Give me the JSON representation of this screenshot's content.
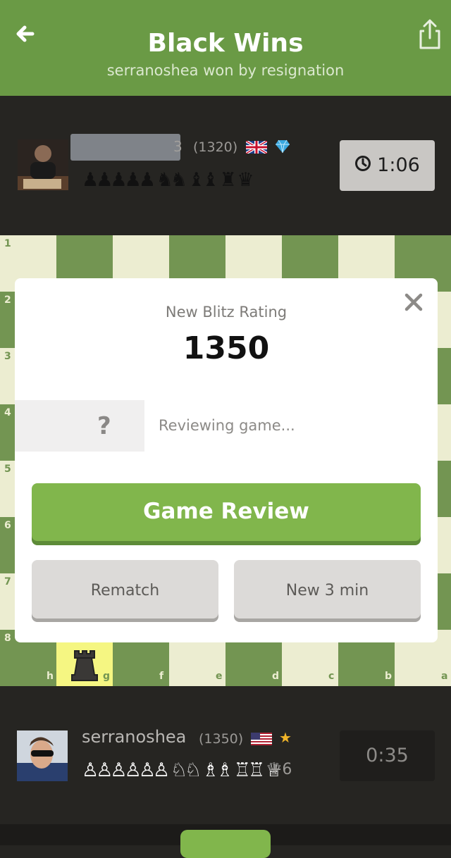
{
  "header": {
    "title": "Black Wins",
    "subtitle": "serranoshea won by resignation"
  },
  "opponent": {
    "name_visible_tail": "3",
    "rating": "(1320)",
    "flag": "uk-flag",
    "badge": "diamond-icon",
    "captured": "♟♟♟♟♟ ♞♞ ♝♝ ♜ ♛",
    "clock": "1:06"
  },
  "player": {
    "name": "serranoshea",
    "rating": "(1350)",
    "flag": "us-flag",
    "badge": "★",
    "captured": "♙♙♙♙♙♙ ♘♘ ♗♗ ♖♖ ♕",
    "material": "+6",
    "clock": "0:35"
  },
  "board": {
    "ranks": [
      "1",
      "2",
      "3",
      "4",
      "5",
      "6",
      "7",
      "8"
    ],
    "files": [
      "h",
      "g",
      "f",
      "e",
      "d",
      "c",
      "b",
      "a"
    ],
    "light_color": "#ecedd1",
    "dark_color": "#739552",
    "highlight_color": "#f5f682"
  },
  "modal": {
    "rating_label": "New Blitz Rating",
    "rating_value": "1350",
    "review_placeholder": "?",
    "review_status": "Reviewing game...",
    "primary_button": "Game Review",
    "rematch_button": "Rematch",
    "new_game_button": "New 3 min"
  },
  "colors": {
    "header_bg": "#6a9a45",
    "accent_green": "#81b64c",
    "page_bg": "#262522"
  },
  "icons": {
    "back": "back-arrow-icon",
    "share": "share-icon",
    "close": "close-icon",
    "clock": "clock-icon"
  }
}
